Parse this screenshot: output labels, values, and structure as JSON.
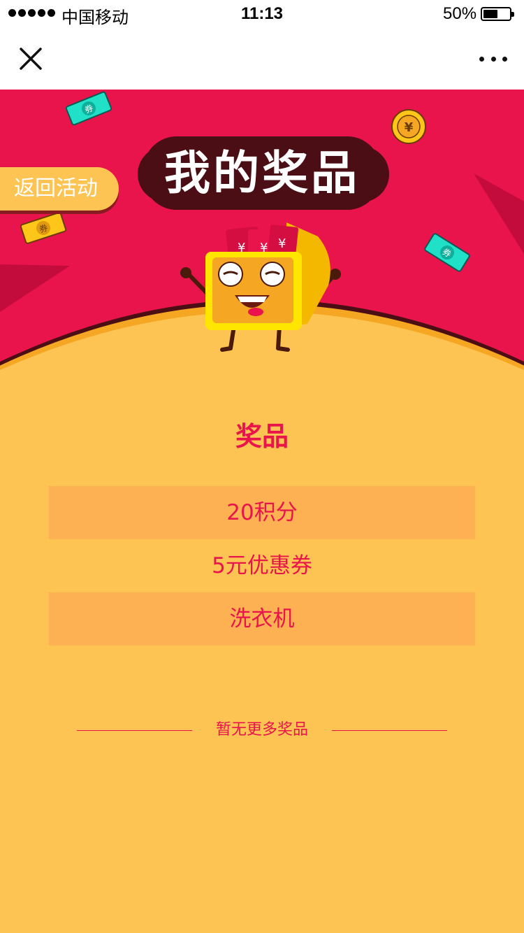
{
  "status_bar": {
    "carrier": "中国移动",
    "time": "11:13",
    "battery": "50%"
  },
  "nav": {
    "close_icon": "close-icon",
    "more_icon": "more-dots-icon"
  },
  "banner": {
    "title": "我的奖品",
    "back_label": "返回活动",
    "coin_glyph": "¥",
    "ticket_glyph": "券",
    "icons": [
      "ticket-icon",
      "coin-icon",
      "mascot-illustration"
    ],
    "colors": {
      "background": "#E8144B",
      "accent": "#FEC453",
      "title_outline": "#4a0e14"
    }
  },
  "prizes": {
    "heading": "奖品",
    "items": [
      {
        "label": "20积分"
      },
      {
        "label": "5元优惠券"
      },
      {
        "label": "洗衣机"
      }
    ],
    "footer_note": "暂无更多奖品"
  },
  "colors": {
    "page_background": "#FEC453",
    "row_shade": "#FEB152",
    "text_accent": "#E8144B"
  }
}
